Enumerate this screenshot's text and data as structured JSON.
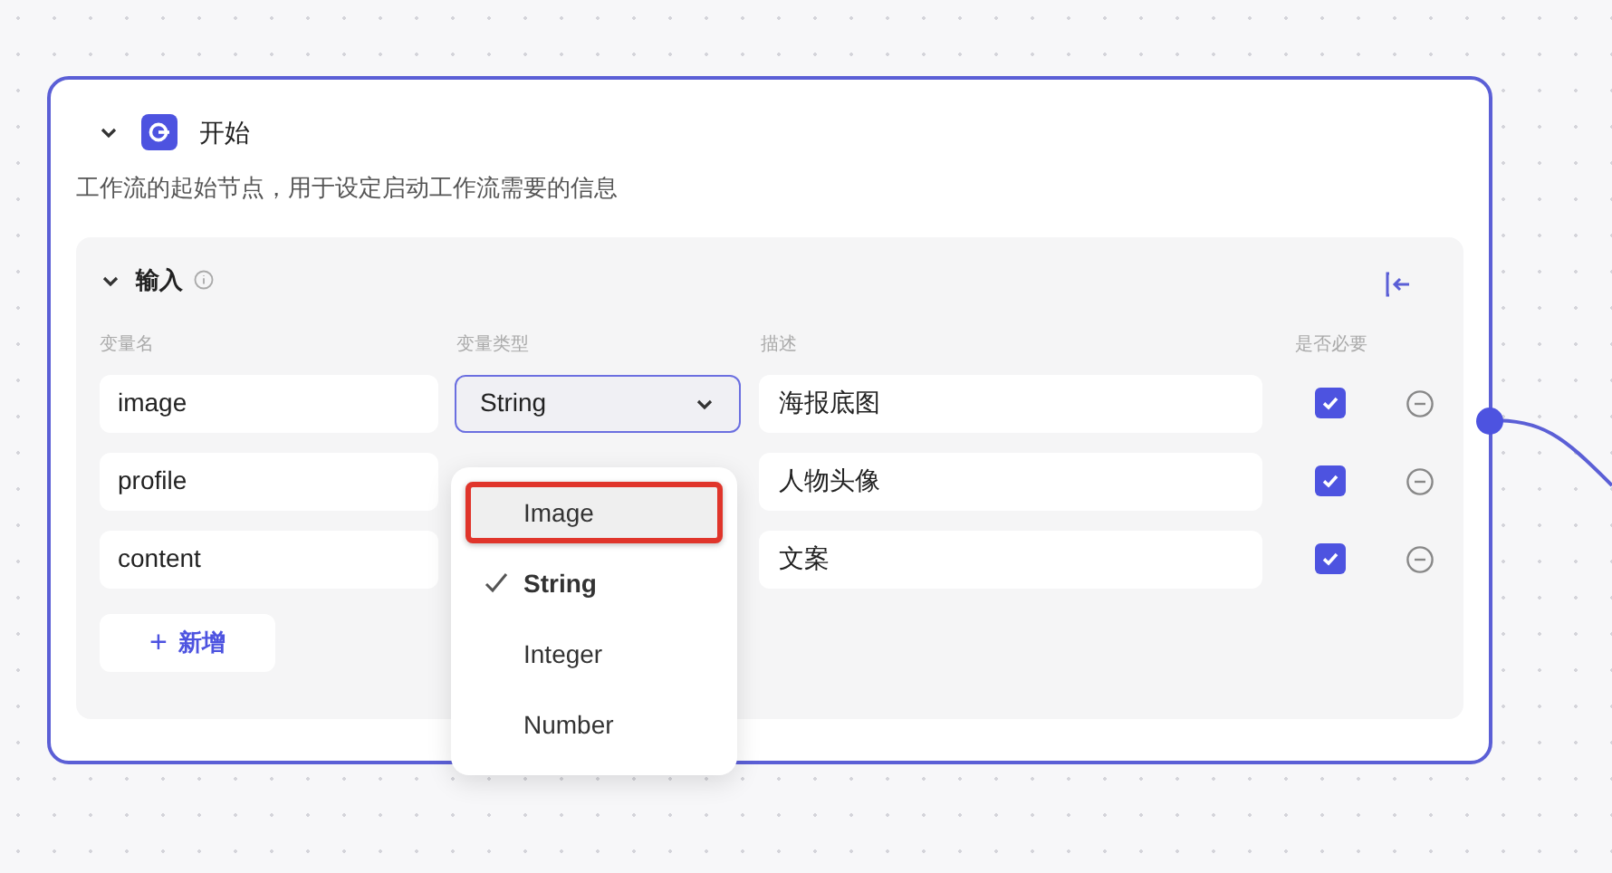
{
  "node": {
    "title": "开始",
    "expanded": true,
    "description": "工作流的起始节点，用于设定启动工作流需要的信息"
  },
  "inputs": {
    "title": "输入",
    "expanded": true,
    "columns": [
      "变量名",
      "变量类型",
      "描述",
      "是否必要"
    ],
    "rows": [
      {
        "name": "image",
        "type": "String",
        "type_focused": true,
        "description": "海报底图",
        "required": true
      },
      {
        "name": "profile",
        "description": "人物头像",
        "required": true
      },
      {
        "name": "content",
        "description": "文案",
        "required": true
      }
    ],
    "add_button": {
      "icon": "+",
      "label": "新增"
    }
  },
  "type_dropdown": {
    "options": [
      {
        "label": "Image",
        "selected": false,
        "highlighted": true
      },
      {
        "label": "String",
        "selected": true,
        "highlighted": false
      },
      {
        "label": "Integer",
        "selected": false,
        "highlighted": false
      },
      {
        "label": "Number",
        "selected": false,
        "highlighted": false
      }
    ]
  }
}
